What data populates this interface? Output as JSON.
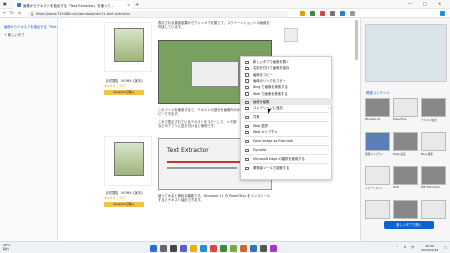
{
  "browser": {
    "tab_title": "画像からテキストを抽出する「Text Extractor」を使って...",
    "tab_close": "×",
    "new_tab": "+",
    "url": "https://www.724488.com/windows/win11-text-extractor",
    "window_controls": [
      "—",
      "□",
      "✕"
    ]
  },
  "sidebar": {
    "items": [
      {
        "label": "画像からテキストを抽出する「Text Ex..."
      },
      {
        "label": "+ 新しいタブ"
      }
    ]
  },
  "page": {
    "intro": "表示される検索結果からウィンドウを閉じて、スクリーンショットの画像を作成しています。",
    "para1": "このツールを使用すると、テキストの部分を画像内のから選択して一度でコピーできます。",
    "para2": "これで表示されているテキストをコピーして、メモ帳などのアプリに貼り付けると便利です。",
    "para3": "使ってみると便利な機能です。Windows 11 の PowerToys をインストールするとテキスト抽出できます。",
    "te_title": "Text Extractor",
    "products": [
      {
        "label": "【月間額】 VIOMA【楽天】",
        "stars": "★★★★☆ 227",
        "amazon": "Amazonで購入"
      },
      {
        "label": "【月間額】 VIOMA【楽天】",
        "stars": "★★★★☆ 227",
        "amazon": "Amazonで購入"
      }
    ]
  },
  "context_menu": {
    "items": [
      {
        "label": "新しいタブで画像を開く",
        "arrow": ""
      },
      {
        "label": "名前を付けて画像を保存",
        "arrow": ""
      },
      {
        "label": "画像をコピー",
        "arrow": ""
      },
      {
        "label": "画像のリンクをコピー",
        "arrow": ""
      },
      {
        "label": "Bing で画像を検索する",
        "arrow": ""
      },
      {
        "label": "Web で画像を検索する",
        "arrow": ""
      },
      {
        "label": "画像を編集",
        "arrow": ""
      },
      {
        "label": "コレクションに追加",
        "arrow": "›"
      },
      {
        "label": "共有",
        "arrow": ""
      },
      {
        "label": "Web 選択",
        "arrow": ""
      },
      {
        "label": "Web キャプチャ",
        "arrow": ""
      },
      {
        "label": "Save image as Evernote",
        "arrow": ""
      },
      {
        "label": "Dynalist",
        "arrow": "›"
      },
      {
        "label": "Microsoft Edge の翻訳を使用する",
        "arrow": ""
      },
      {
        "label": "開発者ツールで調査する",
        "arrow": ""
      }
    ]
  },
  "copilot": {
    "section_title": "関連コンテンツ",
    "thumbs": [
      {
        "caption": "Windows 11"
      },
      {
        "caption": "PowerToys"
      },
      {
        "caption": "テキスト抽出"
      },
      {
        "caption": "画面キャプチャ"
      },
      {
        "caption": "Edge 設定"
      },
      {
        "caption": "Bing 検索"
      },
      {
        "caption": "ショートカット"
      },
      {
        "caption": "OCR"
      },
      {
        "caption": "PDF Extraction"
      }
    ],
    "button_label": "新しいタブで開く"
  },
  "taskbar": {
    "weather_temp": "28°C",
    "weather_desc": "晴れ",
    "ime": "A",
    "time": "20:30",
    "date": "2023/07/23"
  },
  "colors": {
    "accent": "#0b57d0",
    "taskbar": "#eef1f5"
  }
}
